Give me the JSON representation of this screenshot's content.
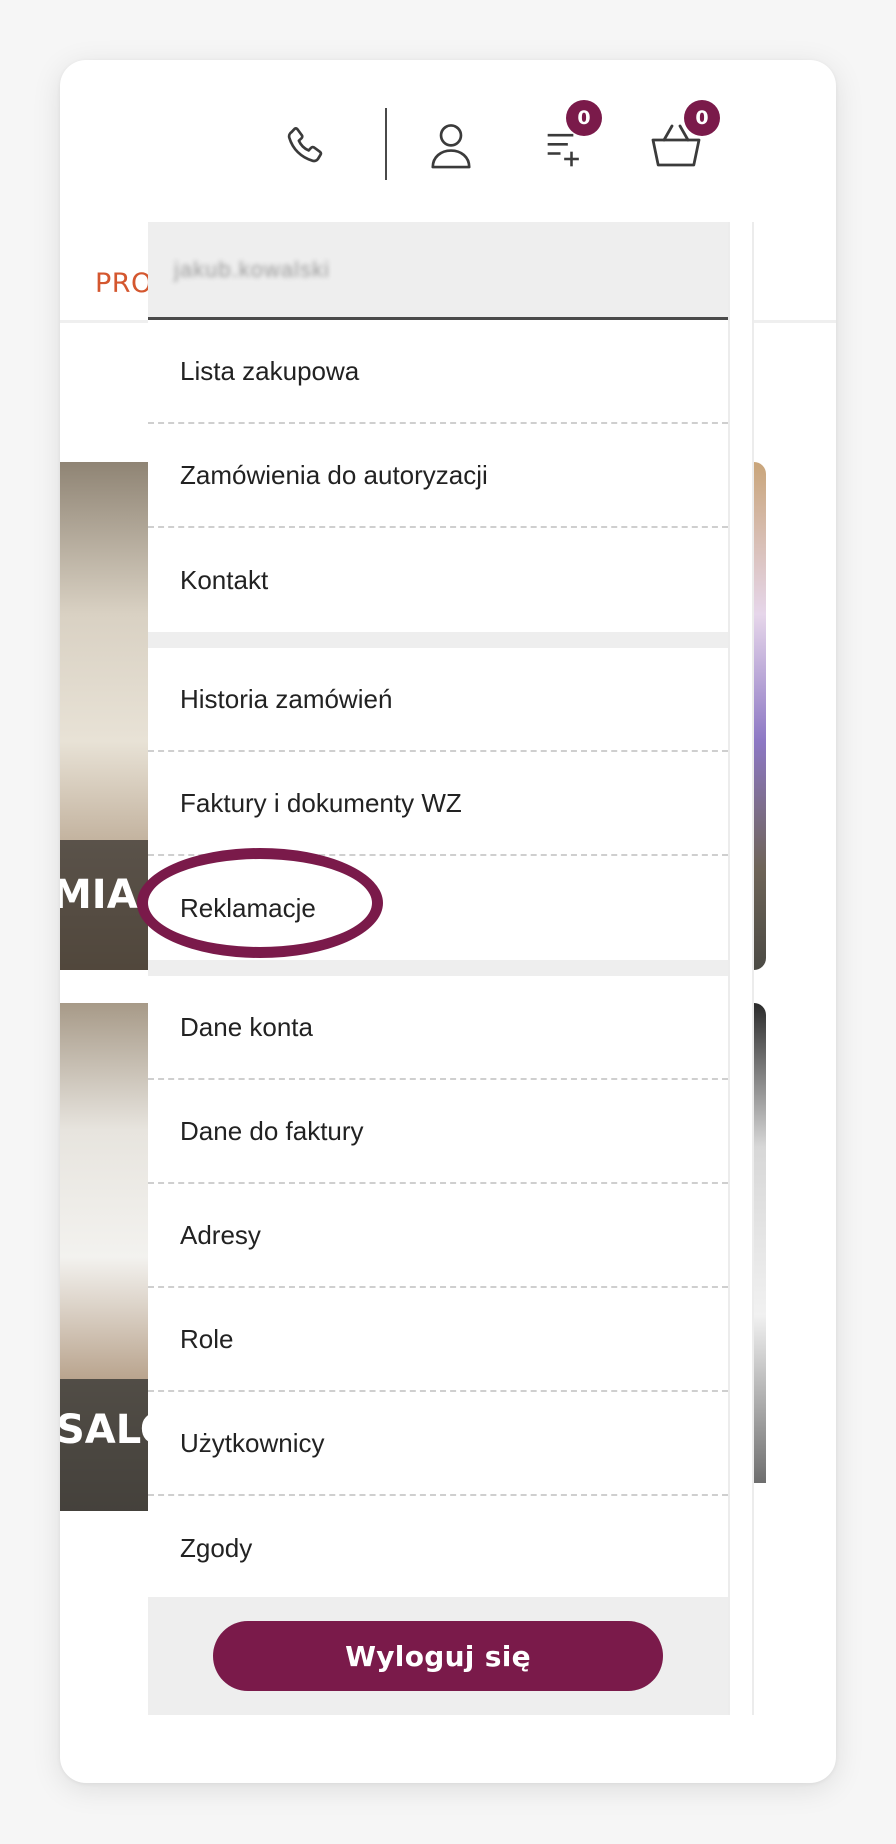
{
  "header": {
    "phone_icon": "phone-icon",
    "account_icon": "user-icon",
    "shopping_list_icon": "list-add-icon",
    "cart_icon": "basket-icon",
    "shopping_list_count": "0",
    "cart_count": "0",
    "accent_color": "#7a1a4a"
  },
  "nav": {
    "promo_label": "PRO"
  },
  "background_cards": [
    {
      "label": "MIA I"
    },
    {
      "label": "SALO"
    }
  ],
  "account_menu": {
    "user_name": "jakub.kowalski",
    "groups": [
      [
        "Lista zakupowa",
        "Zamówienia do autoryzacji",
        "Kontakt"
      ],
      [
        "Historia zamówień",
        "Faktury i dokumenty WZ",
        "Reklamacje"
      ],
      [
        "Dane konta",
        "Dane do faktury",
        "Adresy",
        "Role",
        "Użytkownicy",
        "Zgody"
      ]
    ],
    "highlighted_item": "Reklamacje",
    "logout_label": "Wyloguj się"
  }
}
